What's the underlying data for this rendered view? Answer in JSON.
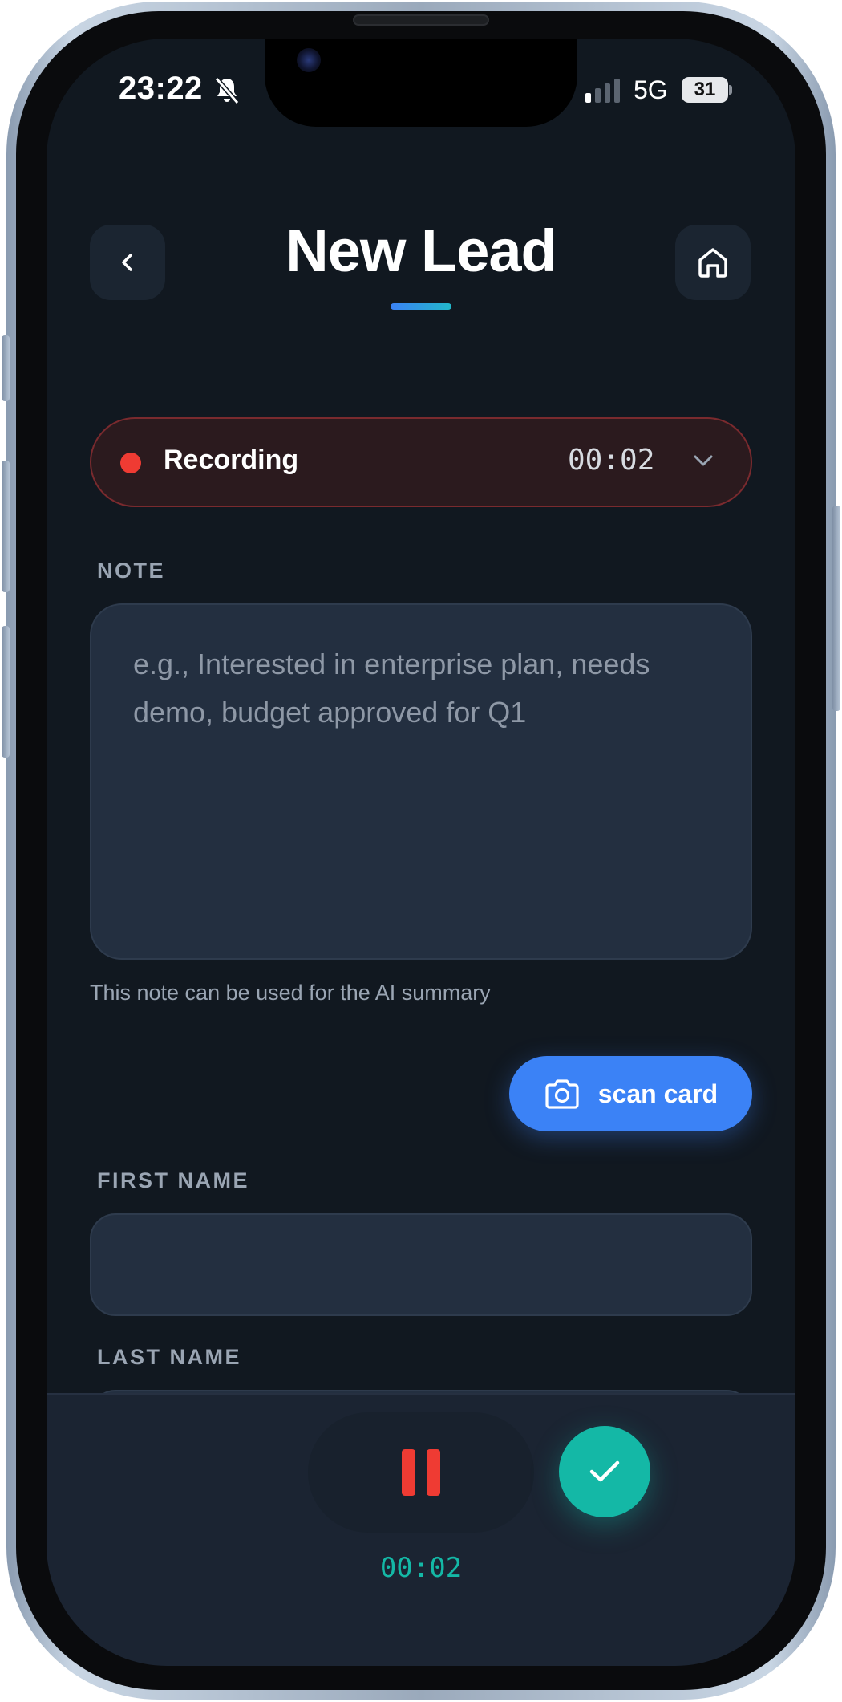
{
  "status_bar": {
    "time": "23:22",
    "network": "5G",
    "battery": "31"
  },
  "header": {
    "title": "New Lead",
    "back_icon": "chevron-left-icon",
    "home_icon": "home-icon"
  },
  "recording": {
    "label": "Recording",
    "timer": "00:02"
  },
  "form": {
    "note_label": "NOTE",
    "note_placeholder": "e.g., Interested in enterprise plan, needs demo, budget approved for Q1",
    "note_hint": "This note can be used for the AI summary",
    "scan_card_label": "scan card",
    "first_name_label": "FIRST NAME",
    "last_name_label": "LAST NAME"
  },
  "dock": {
    "timer": "00:02"
  },
  "colors": {
    "background": "#111820",
    "accent_blue": "#3b82f6",
    "accent_teal": "#14b8a6",
    "recording_red": "#ef3b33"
  }
}
